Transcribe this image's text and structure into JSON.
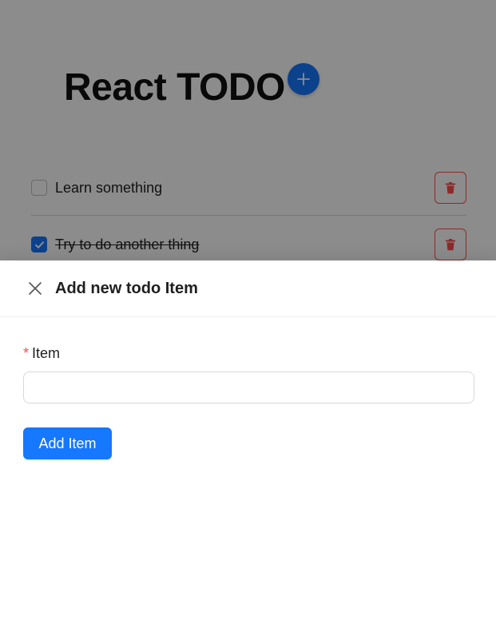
{
  "app": {
    "title": "React TODO",
    "add_icon": "plus-icon",
    "todos": [
      {
        "label": "Learn something",
        "checked": false,
        "delete_icon": "trash-icon"
      },
      {
        "label": "Try to do another thing",
        "checked": true,
        "delete_icon": "trash-icon"
      }
    ]
  },
  "drawer": {
    "title": "Add new todo Item",
    "close_icon": "close-icon",
    "form": {
      "required_mark": "*",
      "item_label": "Item",
      "item_value": "",
      "item_placeholder": "",
      "submit_label": "Add Item"
    }
  },
  "colors": {
    "primary": "#1677ff",
    "danger": "#ff4d4f",
    "mask": "rgba(0,0,0,0.45)"
  }
}
